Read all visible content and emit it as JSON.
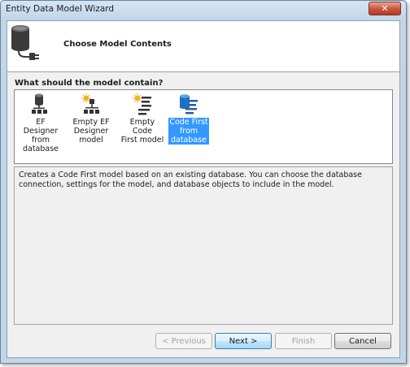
{
  "window": {
    "title": "Entity Data Model Wizard",
    "close_glyph": "✕"
  },
  "header": {
    "title": "Choose Model Contents",
    "icon": "database-plug-icon"
  },
  "question": "What should the model contain?",
  "options": [
    {
      "label": "EF Designer\nfrom\ndatabase",
      "icon": "db-hierarchy-icon",
      "selected": false
    },
    {
      "label": "Empty EF\nDesigner\nmodel",
      "icon": "empty-hierarchy-icon",
      "selected": false
    },
    {
      "label": "Empty Code\nFirst model",
      "icon": "empty-code-icon",
      "selected": false
    },
    {
      "label": "Code First\nfrom\ndatabase",
      "icon": "db-code-icon",
      "selected": true
    }
  ],
  "description": "Creates a Code First model based on an existing database. You can choose the database connection, settings for the model, and database objects to include in the model.",
  "buttons": {
    "previous": "< Previous",
    "next": "Next >",
    "finish": "Finish",
    "cancel": "Cancel"
  },
  "colors": {
    "selection": "#3399ff",
    "close": "#c9523b",
    "frame": "#c2d6ea"
  }
}
